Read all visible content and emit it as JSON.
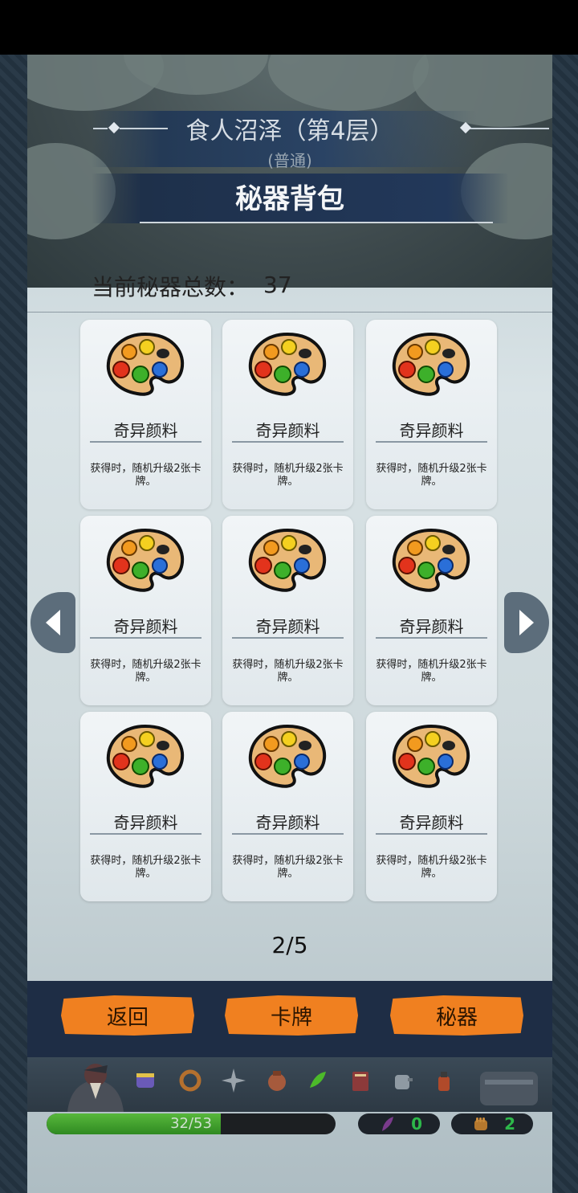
{
  "header": {
    "level_title": "食人沼泽（第4层）",
    "difficulty": "(普通)",
    "panel_title": "秘器背包"
  },
  "summary": {
    "count_label": "当前秘器总数：",
    "count_value": "37"
  },
  "relics": [
    {
      "name": "奇异颜料",
      "desc": "获得时，随机升级2张卡牌。",
      "icon": "paint-palette-icon"
    },
    {
      "name": "奇异颜料",
      "desc": "获得时，随机升级2张卡牌。",
      "icon": "paint-palette-icon"
    },
    {
      "name": "奇异颜料",
      "desc": "获得时，随机升级2张卡牌。",
      "icon": "paint-palette-icon"
    },
    {
      "name": "奇异颜料",
      "desc": "获得时，随机升级2张卡牌。",
      "icon": "paint-palette-icon"
    },
    {
      "name": "奇异颜料",
      "desc": "获得时，随机升级2张卡牌。",
      "icon": "paint-palette-icon"
    },
    {
      "name": "奇异颜料",
      "desc": "获得时，随机升级2张卡牌。",
      "icon": "paint-palette-icon"
    },
    {
      "name": "奇异颜料",
      "desc": "获得时，随机升级2张卡牌。",
      "icon": "paint-palette-icon"
    },
    {
      "name": "奇异颜料",
      "desc": "获得时，随机升级2张卡牌。",
      "icon": "paint-palette-icon"
    },
    {
      "name": "奇异颜料",
      "desc": "获得时，随机升级2张卡牌。",
      "icon": "paint-palette-icon"
    }
  ],
  "pagination": {
    "indicator": "2/5",
    "prev_icon": "chevron-left-icon",
    "next_icon": "chevron-right-icon"
  },
  "actions": {
    "back_label": "返回",
    "cards_label": "卡牌",
    "relics_label": "秘器",
    "button_color": "#f08020"
  },
  "status": {
    "hp_text": "32/53",
    "hp_fraction": 0.6038,
    "feather_count": "0",
    "fist_count": "2",
    "resource_color": "#2db84a"
  },
  "relic_bar_icons": [
    "scroll-icon",
    "ring-icon",
    "shuriken-icon",
    "coin-pouch-icon",
    "chili-pepper-icon",
    "book-icon",
    "kettle-icon",
    "ink-bottle-icon"
  ]
}
